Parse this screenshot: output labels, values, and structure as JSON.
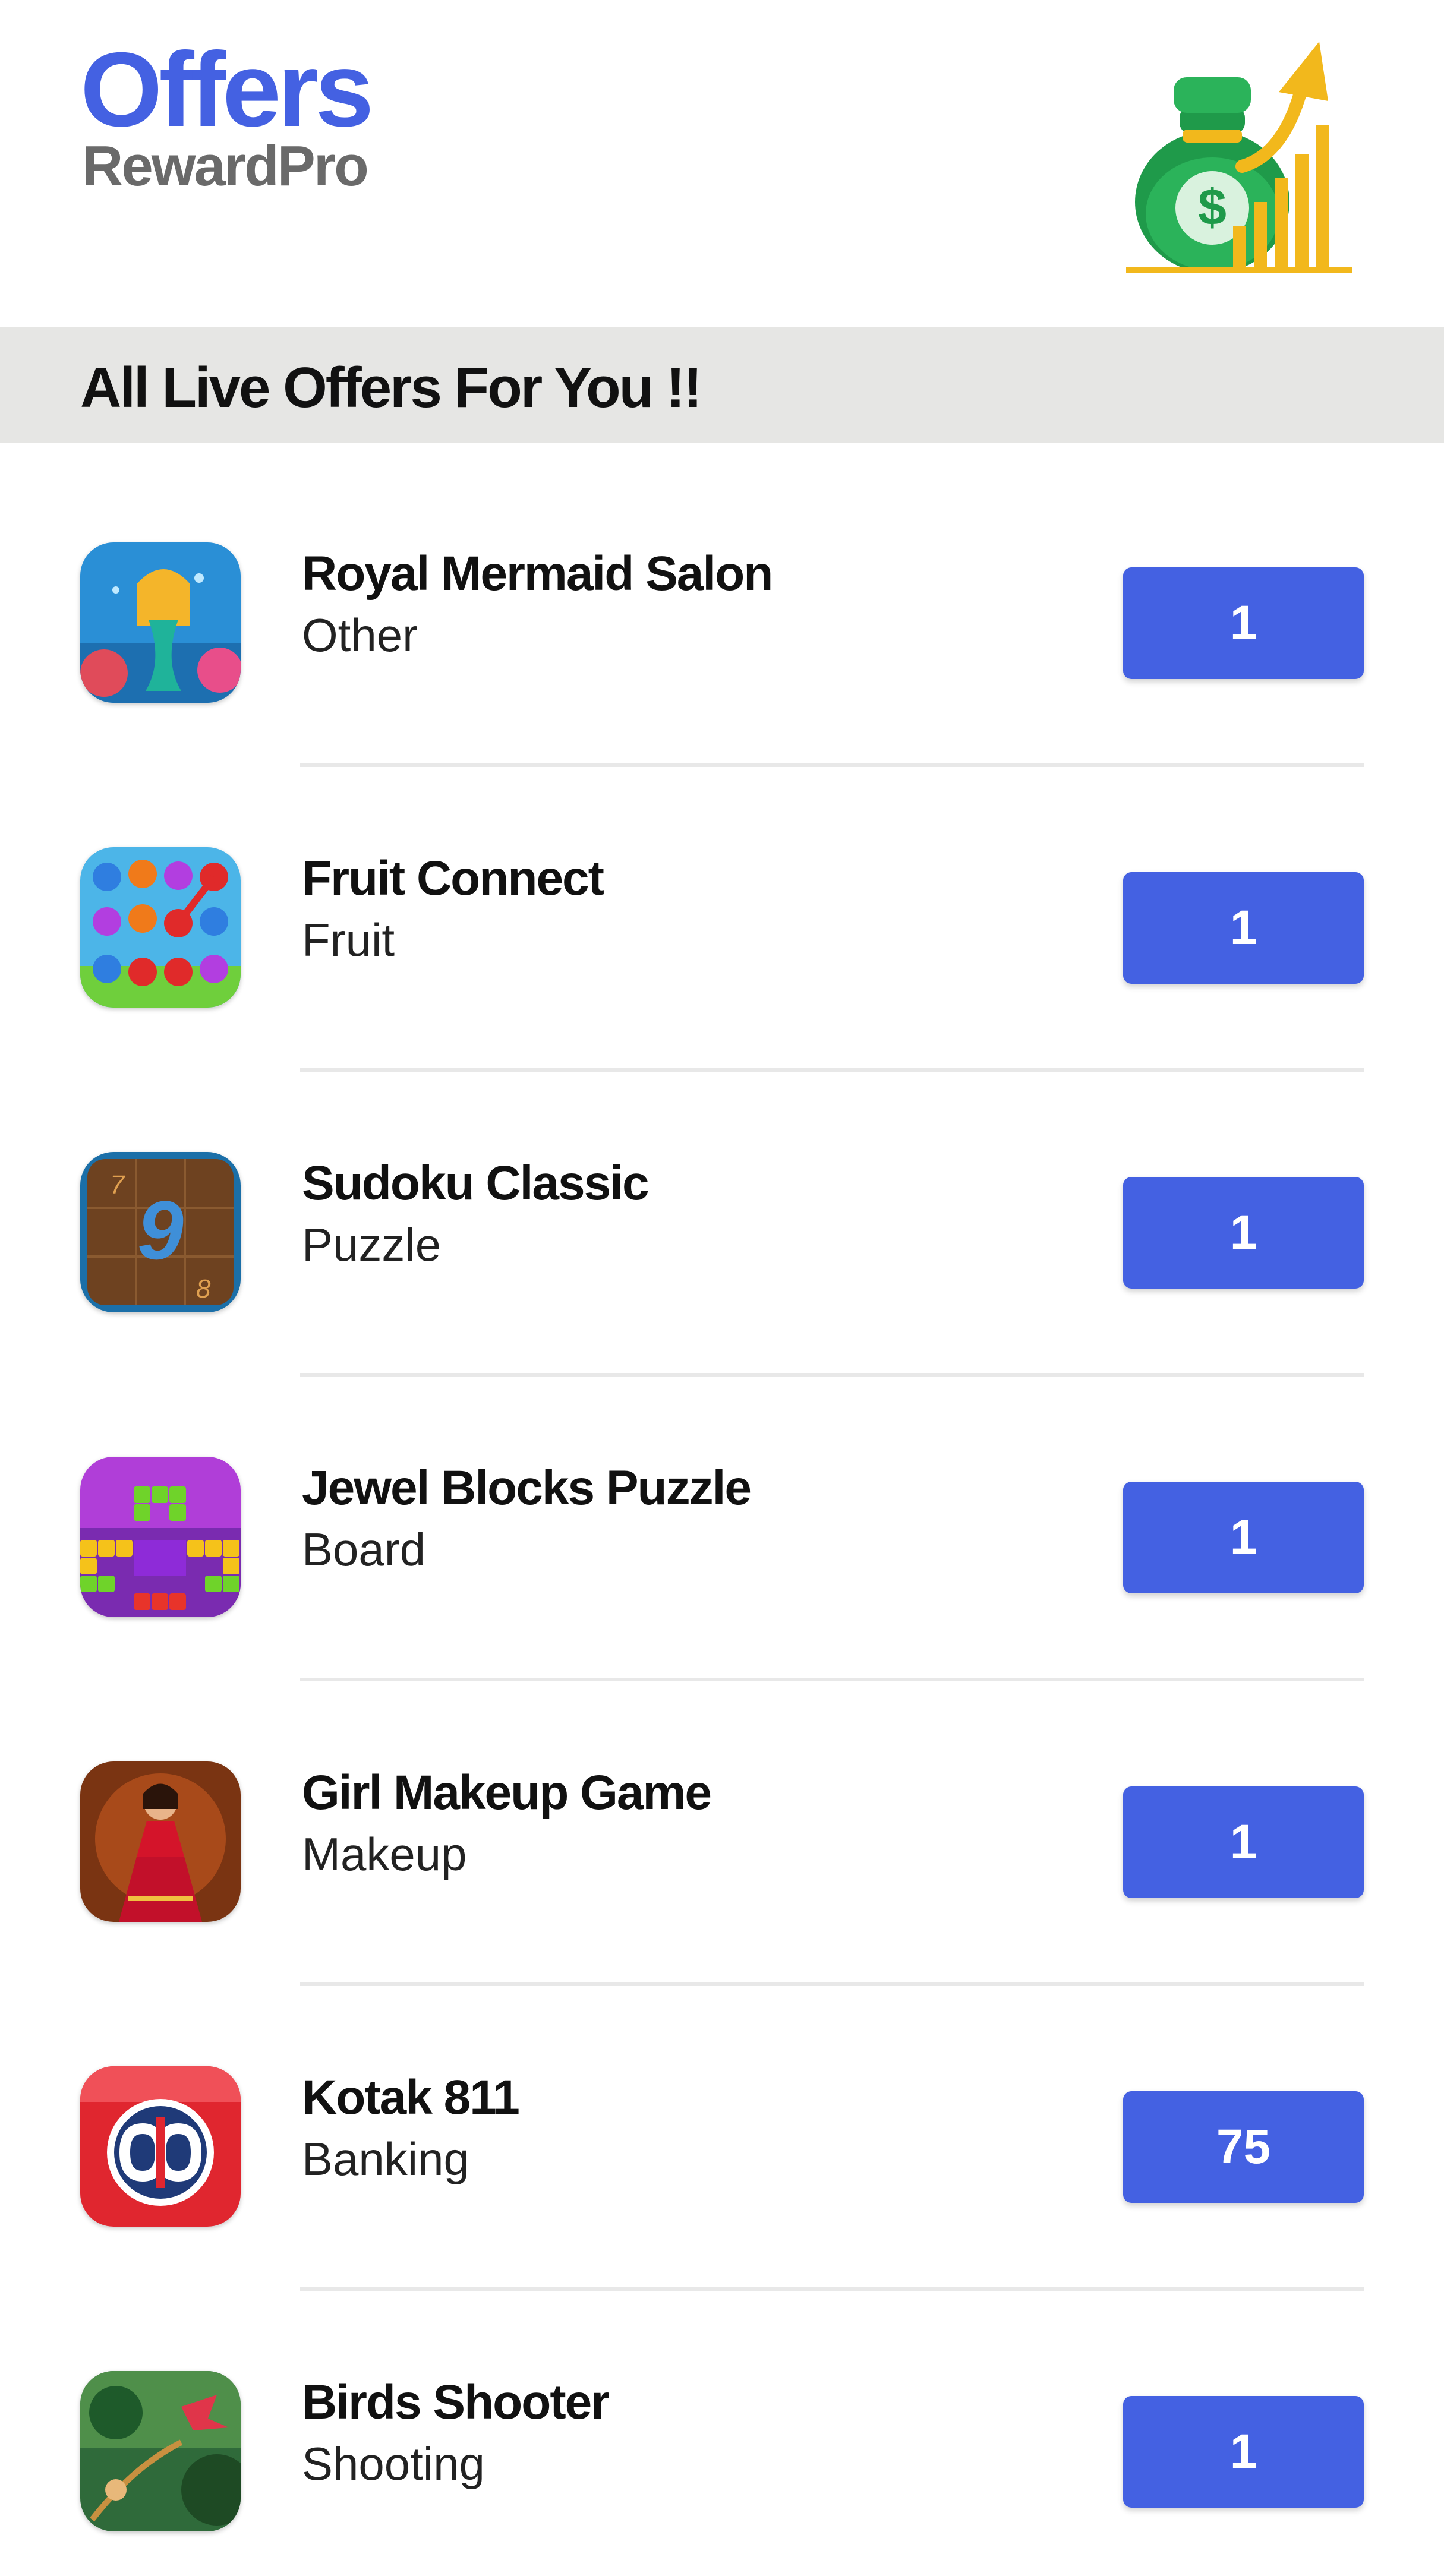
{
  "header": {
    "title": "Offers",
    "subtitle": "RewardPro",
    "logo_icon": "money-bag-growth-icon"
  },
  "banner": {
    "text": "All Live Offers For You !!"
  },
  "colors": {
    "accent": "#4461e2",
    "banner_bg": "#e6e6e4",
    "subtitle": "#6a6a6a"
  },
  "offers": [
    {
      "name": "Royal Mermaid Salon",
      "category": "Other",
      "points": "1",
      "icon": "mermaid-game-icon"
    },
    {
      "name": "Fruit Connect",
      "category": "Fruit",
      "points": "1",
      "icon": "fruit-game-icon"
    },
    {
      "name": "Sudoku Classic",
      "category": "Puzzle",
      "points": "1",
      "icon": "sudoku-icon"
    },
    {
      "name": "Jewel Blocks Puzzle",
      "category": "Board",
      "points": "1",
      "icon": "jewel-blocks-icon"
    },
    {
      "name": "Girl Makeup Game",
      "category": "Makeup",
      "points": "1",
      "icon": "makeup-game-icon"
    },
    {
      "name": "Kotak 811",
      "category": "Banking",
      "points": "75",
      "icon": "kotak-logo-icon"
    },
    {
      "name": "Birds Shooter",
      "category": "Shooting",
      "points": "1",
      "icon": "birds-shooter-icon"
    }
  ]
}
